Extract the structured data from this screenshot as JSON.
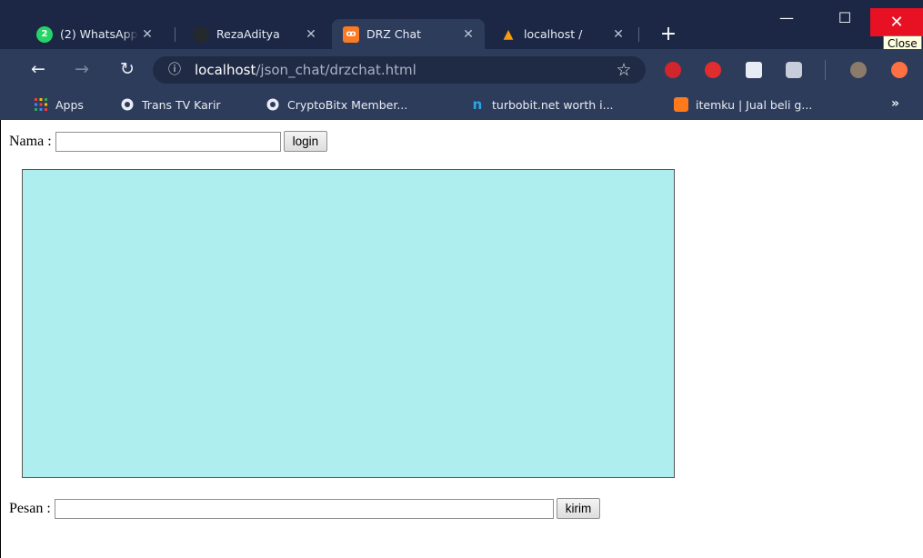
{
  "browser": {
    "tabs": [
      {
        "title": "(2) WhatsApp",
        "icon": "whatsapp-icon",
        "color": "#25d366",
        "active": false
      },
      {
        "title": "RezaAditya",
        "icon": "github-icon",
        "color": "#24292e",
        "active": false
      },
      {
        "title": "DRZ Chat",
        "icon": "xampp-icon",
        "color": "#fb7a24",
        "active": true
      },
      {
        "title": "localhost / ",
        "icon": "phpmyadmin-icon",
        "color": "#f89c0e",
        "active": false
      }
    ],
    "tab_close_glyph": "✕",
    "new_tab_glyph": "+",
    "close_tooltip": "Close",
    "url_host": "localhost",
    "url_path": "/json_chat/drzchat.html",
    "bookmarks": [
      {
        "label": "Apps",
        "icon": "apps-grid-icon"
      },
      {
        "label": "Trans TV Karir",
        "icon": "globe-icon"
      },
      {
        "label": "CryptoBitx Member...",
        "icon": "globe-icon"
      },
      {
        "label": "turbobit.net worth i...",
        "icon": "turbobit-icon"
      },
      {
        "label": "itemku | Jual beli g...",
        "icon": "itemku-icon"
      }
    ],
    "bookmarks_more": "»"
  },
  "page": {
    "name_label": "Nama :",
    "name_value": "",
    "login_label": "login",
    "message_label": "Pesan :",
    "message_value": "",
    "send_label": "kirim",
    "chat_bg": "#afeeee"
  }
}
